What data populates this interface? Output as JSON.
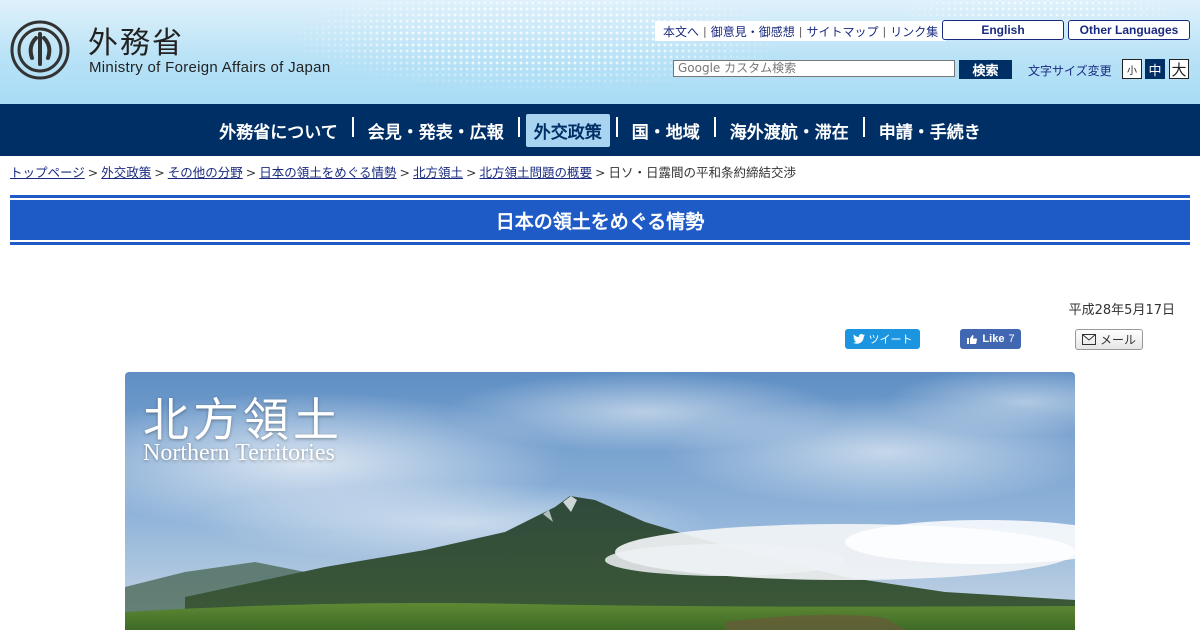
{
  "header": {
    "logo_jp": "外務省",
    "logo_en": "Ministry of Foreign Affairs of Japan",
    "util_links": [
      "本文へ",
      "御意見・御感想",
      "サイトマップ",
      "リンク集"
    ],
    "lang_english": "English",
    "lang_other": "Other Languages",
    "search_placeholder": "Google カスタム検索",
    "search_button": "検索",
    "fontsize_label": "文字サイズ変更",
    "fontsize_small": "小",
    "fontsize_medium": "中",
    "fontsize_large": "大"
  },
  "nav": {
    "items": [
      {
        "label": "外務省について"
      },
      {
        "label": "会見・発表・広報"
      },
      {
        "label": "外交政策",
        "active": true
      },
      {
        "label": "国・地域"
      },
      {
        "label": "海外渡航・滞在"
      },
      {
        "label": "申請・手続き"
      }
    ]
  },
  "breadcrumb": {
    "links": [
      "トップページ",
      "外交政策",
      "その他の分野",
      "日本の領土をめぐる情勢",
      "北方領土",
      "北方領土問題の概要"
    ],
    "current": "日ソ・日露間の平和条約締結交渉"
  },
  "banner": {
    "title": "日本の領土をめぐる情勢"
  },
  "article": {
    "date": "平成28年5月17日"
  },
  "share": {
    "tweet": "ツイート",
    "like": "Like",
    "like_count": "7",
    "mail": "メール"
  },
  "hero": {
    "title_jp": "北方領土",
    "title_en": "Northern Territories"
  },
  "colors": {
    "nav_bg": "#002f65",
    "nav_active_bg": "#a8d4f2",
    "banner_bg": "#1e5bc6",
    "link": "#1a2a80"
  }
}
